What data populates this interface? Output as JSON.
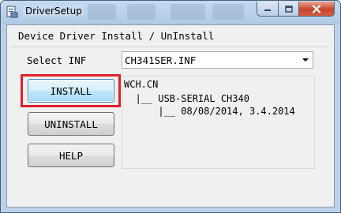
{
  "window": {
    "title": "DriverSetup",
    "controls": [
      "minimize-icon",
      "maximize-icon",
      "close-icon"
    ],
    "colors": {
      "frame": "#bcd2e8",
      "close_button": "#c9452e",
      "highlight_box": "#e0202a"
    }
  },
  "group": {
    "title": "Device Driver Install / UnInstall"
  },
  "inf_select": {
    "label": "Select INF",
    "value": "CH341SER.INF"
  },
  "buttons": {
    "install": "INSTALL",
    "uninstall": "UNINSTALL",
    "help": "HELP"
  },
  "driver_info": {
    "lines": [
      "WCH.CN",
      "  |__ USB-SERIAL CH340",
      "      |__ 08/08/2014, 3.4.2014"
    ]
  }
}
